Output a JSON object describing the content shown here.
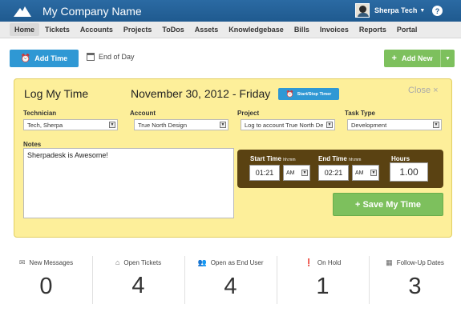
{
  "header": {
    "company": "My Company Name",
    "user_name": "Sherpa Tech",
    "help": "?"
  },
  "nav": [
    "Home",
    "Tickets",
    "Accounts",
    "Projects",
    "ToDos",
    "Assets",
    "Knowledgebase",
    "Bills",
    "Invoices",
    "Reports",
    "Portal"
  ],
  "nav_active": "Home",
  "actions": {
    "add_time": "Add Time",
    "end_of_day": "End of Day",
    "add_new": "Add New"
  },
  "log": {
    "title": "Log My Time",
    "date": "November 30, 2012 - Friday",
    "timer_button": "Start/Stop Timer",
    "close": "Close ×",
    "technician": {
      "label": "Technician",
      "value": "Tech, Sherpa"
    },
    "account": {
      "label": "Account",
      "value": "True North Design"
    },
    "project": {
      "label": "Project",
      "value": "Log to account True North De"
    },
    "task_type": {
      "label": "Task Type",
      "value": "Development"
    },
    "notes": {
      "label": "Notes",
      "value": "Sherpadesk is Awesome!"
    },
    "start_time": {
      "label": "Start Time",
      "hint": "hh:mm",
      "value": "01:21",
      "ampm": "AM"
    },
    "end_time": {
      "label": "End Time",
      "hint": "hh:mm",
      "value": "02:21",
      "ampm": "AM"
    },
    "hours": {
      "label": "Hours",
      "value": "1.00"
    },
    "save": "+ Save My Time"
  },
  "stats": [
    {
      "label": "New Messages",
      "value": "0",
      "icon": "envelope-icon"
    },
    {
      "label": "Open Tickets",
      "value": "4",
      "icon": "inbox-icon"
    },
    {
      "label": "Open as End User",
      "value": "4",
      "icon": "users-icon"
    },
    {
      "label": "On Hold",
      "value": "1",
      "icon": "alert-icon"
    },
    {
      "label": "Follow-Up Dates",
      "value": "3",
      "icon": "calendar-icon"
    }
  ],
  "colors": {
    "header": "#1f5a8f",
    "blue_button": "#2f98d4",
    "green_button": "#7dc05d",
    "panel_bg": "#fdef9a",
    "time_box": "#5a4212"
  }
}
